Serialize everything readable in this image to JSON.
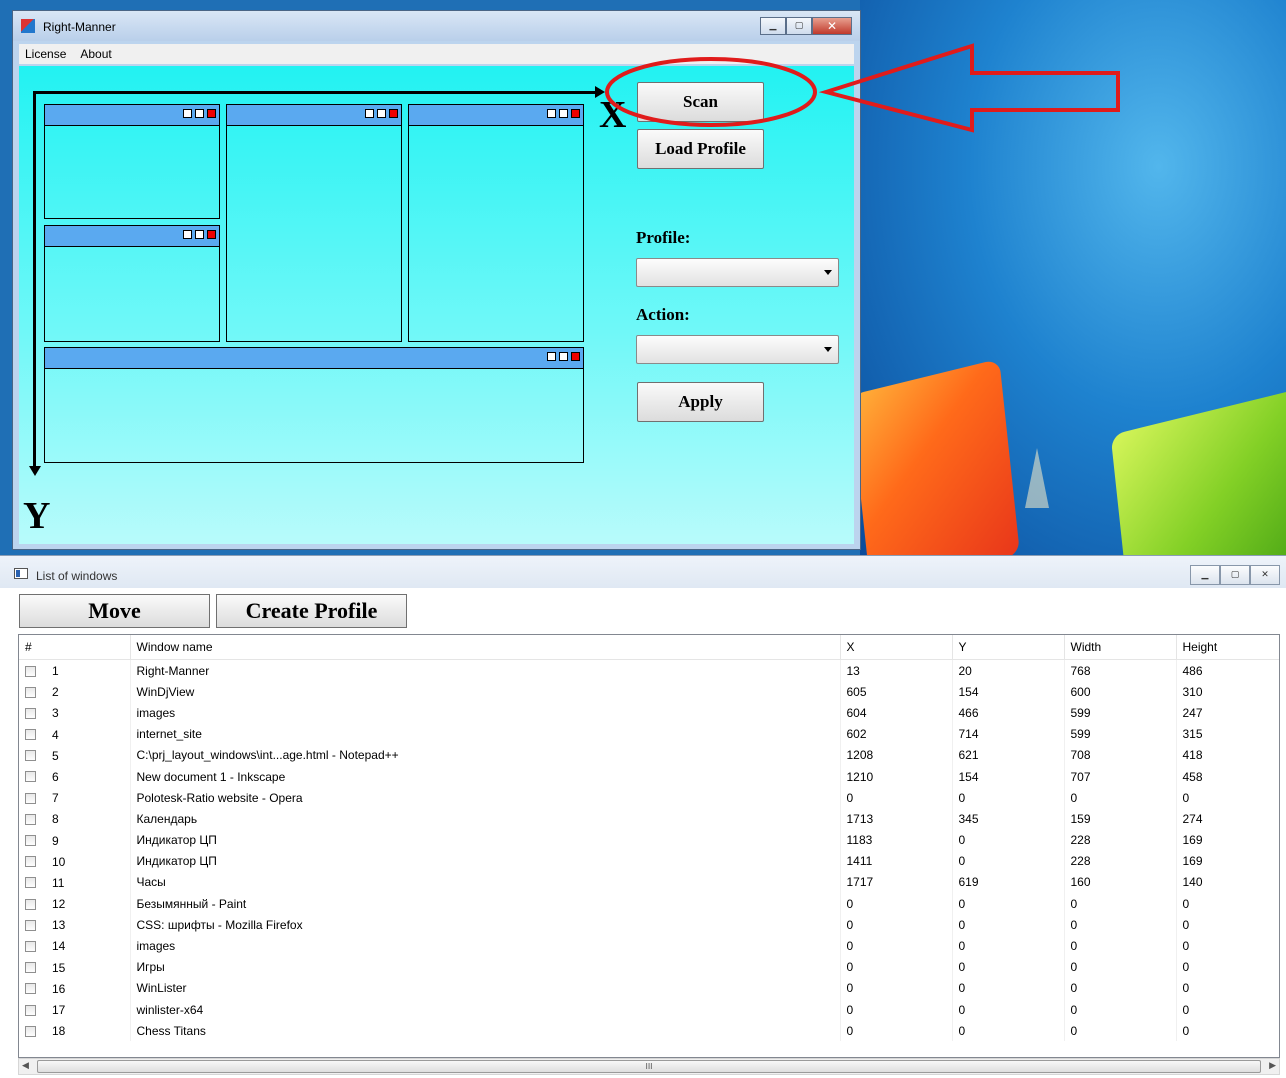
{
  "colors": {
    "rm_client_top": "#22f2f2",
    "mini_bar": "#5aa9f0",
    "annotation_red": "#e01b1b"
  },
  "rm_window": {
    "title": "Right-Manner",
    "menu": [
      "License",
      "About"
    ],
    "axis": {
      "x_label": "X",
      "y_label": "Y"
    },
    "buttons": {
      "scan": "Scan",
      "load_profile": "Load Profile",
      "apply": "Apply"
    },
    "profile_label": "Profile:",
    "action_label": "Action:",
    "profile_value": "",
    "action_value": ""
  },
  "list_window": {
    "title": "List of windows",
    "buttons": {
      "move": "Move",
      "create_profile": "Create Profile"
    },
    "columns": [
      "#",
      "Window name",
      "X",
      "Y",
      "Width",
      "Height"
    ],
    "rows": [
      [
        "1",
        "Right-Manner",
        "13",
        "20",
        "768",
        "486"
      ],
      [
        "2",
        "WinDjView",
        "605",
        "154",
        "600",
        "310"
      ],
      [
        "3",
        "images",
        "604",
        "466",
        "599",
        "247"
      ],
      [
        "4",
        "internet_site",
        "602",
        "714",
        "599",
        "315"
      ],
      [
        "5",
        "C:\\prj_layout_windows\\int...age.html - Notepad++",
        "1208",
        "621",
        "708",
        "418"
      ],
      [
        "6",
        "New document 1 - Inkscape",
        "1210",
        "154",
        "707",
        "458"
      ],
      [
        "7",
        "Polotesk-Ratio website - Opera",
        "0",
        "0",
        "0",
        "0"
      ],
      [
        "8",
        "Календарь",
        "1713",
        "345",
        "159",
        "274"
      ],
      [
        "9",
        "Индикатор ЦП",
        "1183",
        "0",
        "228",
        "169"
      ],
      [
        "10",
        "Индикатор ЦП",
        "1411",
        "0",
        "228",
        "169"
      ],
      [
        "11",
        "Часы",
        "1717",
        "619",
        "160",
        "140"
      ],
      [
        "12",
        "Безымянный - Paint",
        "0",
        "0",
        "0",
        "0"
      ],
      [
        "13",
        "CSS: шрифты - Mozilla Firefox",
        "0",
        "0",
        "0",
        "0"
      ],
      [
        "14",
        "images",
        "0",
        "0",
        "0",
        "0"
      ],
      [
        "15",
        "Игры",
        "0",
        "0",
        "0",
        "0"
      ],
      [
        "16",
        "WinLister",
        "0",
        "0",
        "0",
        "0"
      ],
      [
        "17",
        "winlister-x64",
        "0",
        "0",
        "0",
        "0"
      ],
      [
        "18",
        "Chess Titans",
        "0",
        "0",
        "0",
        "0"
      ]
    ],
    "scrollbar_grip": "III"
  }
}
